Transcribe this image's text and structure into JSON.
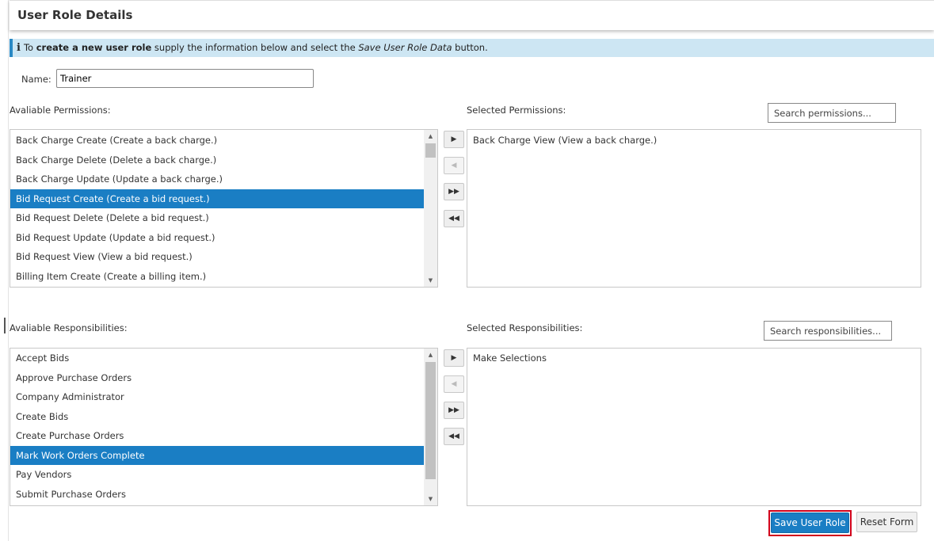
{
  "page": {
    "title": "User Role Details"
  },
  "info": {
    "icon": "info-icon",
    "text_before": "To ",
    "bold": "create a new user role",
    "text_middle": " supply the information below and select the ",
    "italic": "Save User Role Data",
    "text_after": " button."
  },
  "form": {
    "name_label": "Name:",
    "name_value": "Trainer"
  },
  "permissions": {
    "available_label": "Avaliable Permissions:",
    "selected_label": "Selected Permissions:",
    "search_placeholder": "Search permissions...",
    "available": [
      "Back Charge Create (Create a back charge.)",
      "Back Charge Delete (Delete a back charge.)",
      "Back Charge Update (Update a back charge.)",
      "Bid Request Create (Create a bid request.)",
      "Bid Request Delete (Delete a bid request.)",
      "Bid Request Update (Update a bid request.)",
      "Bid Request View (View a bid request.)",
      "Billing Item Create (Create a billing item.)"
    ],
    "selected_index": 3,
    "selected": [
      "Back Charge View (View a back charge.)"
    ]
  },
  "responsibilities": {
    "available_label": "Avaliable Responsibilities:",
    "selected_label": "Selected Responsibilities:",
    "search_placeholder": "Search responsibilities...",
    "available": [
      "Accept Bids",
      "Approve Purchase Orders",
      "Company Administrator",
      "Create Bids",
      "Create Purchase Orders",
      "Mark Work Orders Complete",
      "Pay Vendors",
      "Submit Purchase Orders"
    ],
    "selected_index": 5,
    "selected": [
      "Make Selections"
    ]
  },
  "move_buttons": {
    "move_right": "▶",
    "move_left": "◀",
    "move_all_right": "▶▶",
    "move_all_left": "◀◀"
  },
  "actions": {
    "save_label": "Save User Role",
    "reset_label": "Reset Form"
  },
  "colors": {
    "accent": "#1a7ec4",
    "info_bg": "#cde6f3",
    "highlight_border": "#d0021b"
  }
}
